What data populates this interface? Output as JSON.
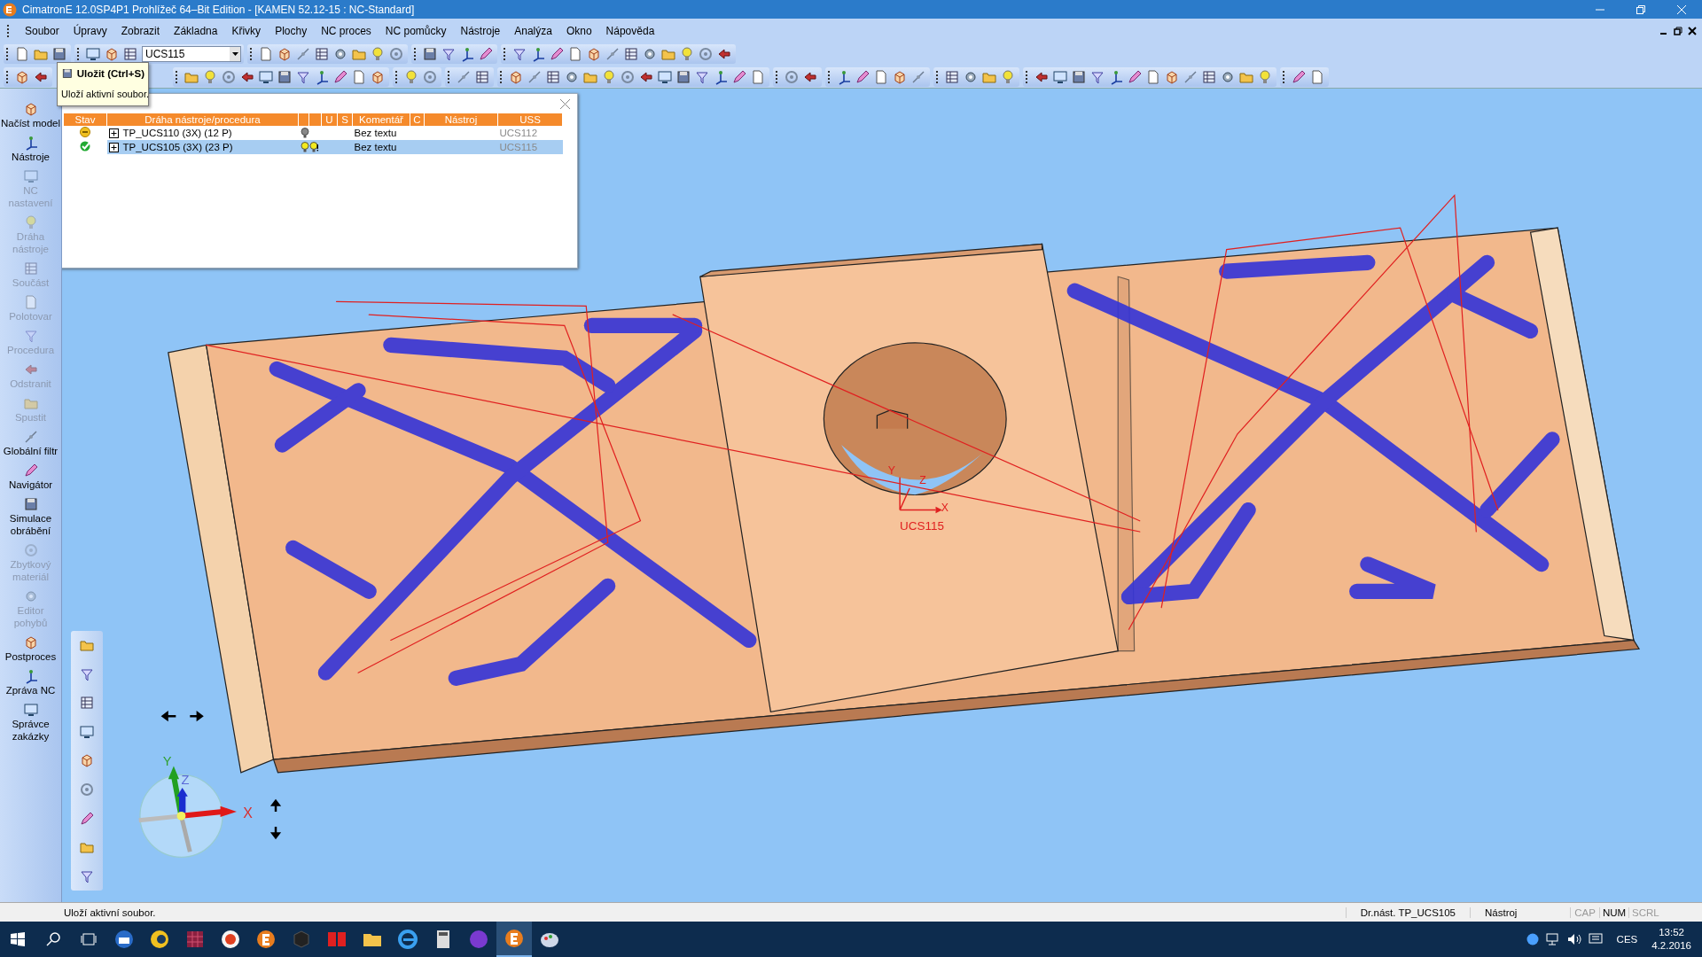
{
  "window": {
    "title": "CimatronE 12.0SP4P1  Prohlížeč 64–Bit Edition - [KAMEN 52.12-15 : NC-Standard]"
  },
  "menu": [
    "Soubor",
    "Úpravy",
    "Zobrazit",
    "Základna",
    "Křivky",
    "Plochy",
    "NC proces",
    "NC pomůcky",
    "Nástroje",
    "Analýza",
    "Okno",
    "Nápověda"
  ],
  "toolbar": {
    "ucs_combo": "UCS115"
  },
  "tooltip": {
    "title": "Uložit  (Ctrl+S)",
    "text": "Uloží aktivní soubor."
  },
  "sidebar": {
    "items": [
      {
        "label": "Načíst model",
        "disabled": false
      },
      {
        "label": "Nástroje",
        "disabled": false
      },
      {
        "label": "NC nastavení",
        "disabled": true
      },
      {
        "label": "Dráha nástroje",
        "disabled": true
      },
      {
        "label": "Součást",
        "disabled": true
      },
      {
        "label": "Polotovar",
        "disabled": true
      },
      {
        "label": "Procedura",
        "disabled": true
      },
      {
        "label": "Odstranit",
        "disabled": true
      },
      {
        "label": "Spustit",
        "disabled": true
      },
      {
        "label": "Globální filtr",
        "disabled": false
      },
      {
        "label": "Navigátor",
        "disabled": false
      },
      {
        "label": "Simulace obrábění",
        "disabled": false
      },
      {
        "label": "Zbytkový materiál",
        "disabled": true
      },
      {
        "label": "Editor pohybů",
        "disabled": true
      },
      {
        "label": "Postproces",
        "disabled": false
      },
      {
        "label": "Zpráva NC",
        "disabled": false
      },
      {
        "label": "Správce zakázky",
        "disabled": false
      }
    ]
  },
  "nc_panel": {
    "columns": [
      {
        "label": "Stav"
      },
      {
        "label": "Dráha nástroje/procedura"
      },
      {
        "label": "U"
      },
      {
        "label": "S"
      },
      {
        "label": "Komentář"
      },
      {
        "label": "C"
      },
      {
        "label": "Nástroj"
      },
      {
        "label": "USS"
      }
    ],
    "rows": [
      {
        "kind": "pending",
        "expanded": false,
        "name": "TP_UCS110 (3X) (12 P)",
        "lights": [
          {
            "kind": "off"
          }
        ],
        "comment": "Bez textu",
        "uss": "UCS112",
        "selected": false
      },
      {
        "kind": "done",
        "expanded": false,
        "name": "TP_UCS105 (3X) (23 P)",
        "lights": [
          {
            "kind": "on"
          },
          {
            "kind": "alert"
          }
        ],
        "comment": "Bez textu",
        "uss": "UCS115",
        "selected": true
      }
    ]
  },
  "viewport": {
    "ucs_label": "UCS115",
    "ucs_axes": [
      "Y",
      "Z",
      "X"
    ],
    "triad_axes": [
      "Y",
      "Z",
      "X"
    ]
  },
  "status_bar": {
    "message": "Uloží aktivní soubor.",
    "toolpath": "Dr.nást. TP_UCS105",
    "tool": "Nástroj",
    "indicators": [
      {
        "label": "CAP",
        "on": false
      },
      {
        "label": "NUM",
        "on": true
      },
      {
        "label": "SCRL",
        "on": false
      }
    ]
  },
  "taskbar": {
    "apps": [
      {
        "kind": "mail",
        "selected": false
      },
      {
        "kind": "ring",
        "selected": false
      },
      {
        "kind": "grid",
        "selected": false
      },
      {
        "kind": "orb",
        "selected": false
      },
      {
        "kind": "e-badge",
        "selected": false
      },
      {
        "kind": "cube",
        "selected": false
      },
      {
        "kind": "tiles",
        "selected": false
      },
      {
        "kind": "folder",
        "selected": false
      },
      {
        "kind": "e-browser",
        "selected": false
      },
      {
        "kind": "calculator",
        "selected": false
      },
      {
        "kind": "purple-orb",
        "selected": false
      },
      {
        "kind": "e-badge",
        "selected": true
      },
      {
        "kind": "palette",
        "selected": false
      }
    ]
  },
  "tray": {
    "language": "CES",
    "time": "13:52",
    "date": "4.2.2016"
  }
}
